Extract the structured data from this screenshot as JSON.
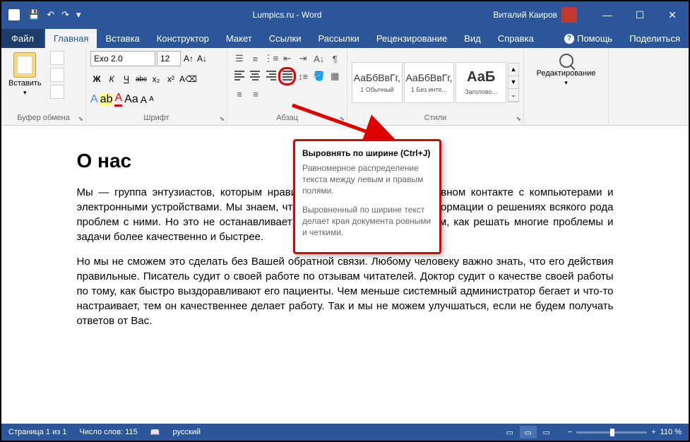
{
  "title": "Lumpics.ru - Word",
  "user": "Виталий Каиров",
  "win": {
    "min": "—",
    "max": "☐",
    "close": "✕"
  },
  "tabs": {
    "file": "Файл",
    "items": [
      "Главная",
      "Вставка",
      "Конструктор",
      "Макет",
      "Ссылки",
      "Рассылки",
      "Рецензирование",
      "Вид",
      "Справка"
    ],
    "help": "Помощь",
    "share": "Поделиться"
  },
  "ribbon": {
    "clipboard": {
      "label": "Буфер обмена",
      "paste": "Вставить"
    },
    "font": {
      "label": "Шрифт",
      "name": "Exo 2.0",
      "size": "12",
      "bold": "Ж",
      "italic": "К",
      "underline": "Ч",
      "strike": "abc",
      "sub": "x₂",
      "sup": "x²",
      "txteffect": "A",
      "highlight": "ab",
      "color": "A",
      "case": "Aa",
      "clearfmt": "A",
      "bigger": "A",
      "smaller": "A"
    },
    "paragraph": {
      "label": "Абзац"
    },
    "styles": {
      "label": "Стили",
      "items": [
        {
          "preview": "АаБбВвГг,",
          "name": "1 Обычный"
        },
        {
          "preview": "АаБбВвГг,",
          "name": "1 Без инте..."
        },
        {
          "preview": "АаБ",
          "name": "Заголово..."
        }
      ]
    },
    "editing": {
      "label": "Редактирование"
    }
  },
  "tooltip": {
    "title": "Выровнять по ширине (Ctrl+J)",
    "p1": "Равномерное распределение текста между левым и правым полями.",
    "p2": "Выровненный по ширине текст делает края документа ровными и четкими."
  },
  "doc": {
    "heading": "О нас",
    "p1": "Мы — группа энтузиастов, которым нравится помогать Вам в ежедневном контакте с компьютерами и электронными устройствами. Мы знаем, что в интернете уже полно информации о решениях всякого рода проблем с ними. Но это не останавливает нас, чтобы рассказывать Вам, как решать многие проблемы и задачи более качественно и быстрее.",
    "p2": "Но мы не сможем это сделать без Вашей обратной связи. Любому человеку важно знать, что его действия правильные. Писатель судит о своей работе по отзывам читателей. Доктор судит о качестве своей работы по тому, как быстро выздоравливают его пациенты. Чем меньше системный администратор бегает и что-то настраивает, тем он качественнее делает работу. Так и мы не можем улучшаться, если не будем получать ответов от Вас."
  },
  "status": {
    "page": "Страница 1 из 1",
    "words": "Число слов: 115",
    "lang": "русский",
    "zoom": "110 %",
    "minus": "−",
    "plus": "+"
  }
}
